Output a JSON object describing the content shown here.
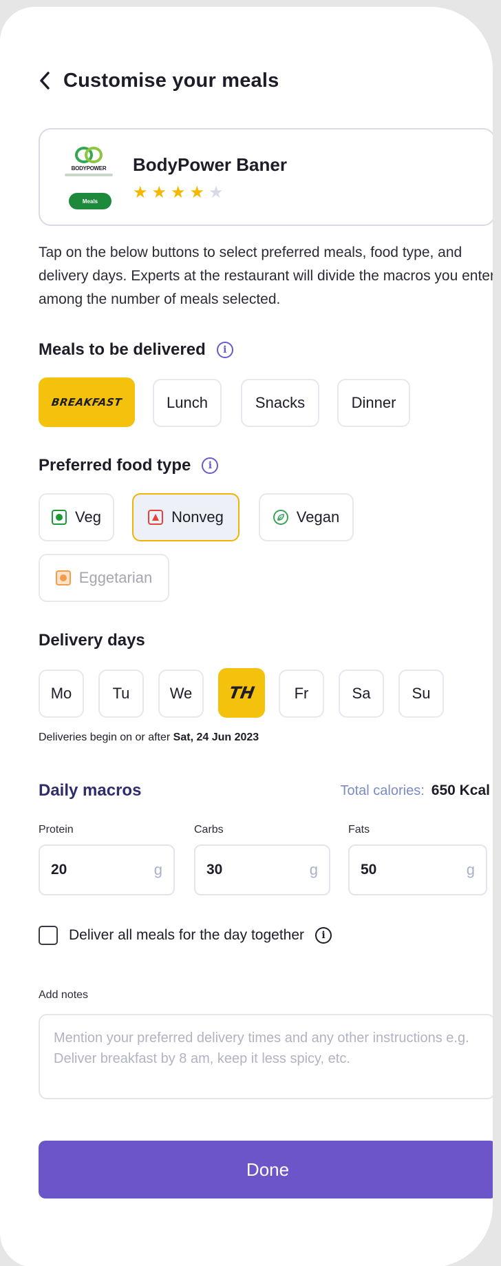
{
  "header": {
    "title": "Customise your meals"
  },
  "restaurant": {
    "name": "BodyPower Baner",
    "logo_text": "BODYPOWER",
    "badge": "Meals",
    "rating": 4,
    "rating_max": 5
  },
  "info_text": "Tap on the below buttons to select preferred meals, food type, and delivery days. Experts at the restaurant will divide the macros you enter among the number of meals selected.",
  "meals": {
    "title": "Meals to be delivered",
    "options": [
      "BREAKFAST",
      "Lunch",
      "Snacks",
      "Dinner"
    ],
    "selected": "BREAKFAST"
  },
  "food_type": {
    "title": "Preferred food type",
    "options": [
      "Veg",
      "Nonveg",
      "Vegan",
      "Eggetarian"
    ],
    "selected": "Nonveg",
    "disabled": [
      "Eggetarian"
    ],
    "colors": {
      "veg": "#1c9a3a",
      "nonveg": "#e0443a",
      "vegan": "#3aa35b",
      "egg": "#f59c4a"
    }
  },
  "delivery": {
    "title": "Delivery days",
    "days": [
      "Mo",
      "Tu",
      "We",
      "TH",
      "Fr",
      "Sa",
      "Su"
    ],
    "selected": "TH",
    "note_prefix": "Deliveries begin on or after",
    "note_date": "Sat, 24 Jun 2023"
  },
  "macros": {
    "title": "Daily macros",
    "total_label": "Total calories:",
    "total_value": "650 Kcal",
    "items": [
      {
        "label": "Protein",
        "value": "20",
        "unit": "g"
      },
      {
        "label": "Carbs",
        "value": "30",
        "unit": "g"
      },
      {
        "label": "Fats",
        "value": "50",
        "unit": "g"
      }
    ]
  },
  "deliver_together": {
    "label": "Deliver all meals for the day together",
    "checked": false
  },
  "notes": {
    "label": "Add notes",
    "placeholder": "Mention your preferred delivery times and any other instructions e.g. Deliver breakfast by 8 am, keep it less spicy, etc."
  },
  "done_label": "Done",
  "colors": {
    "accent": "#6c55c9",
    "yellow": "#f4c20d"
  }
}
